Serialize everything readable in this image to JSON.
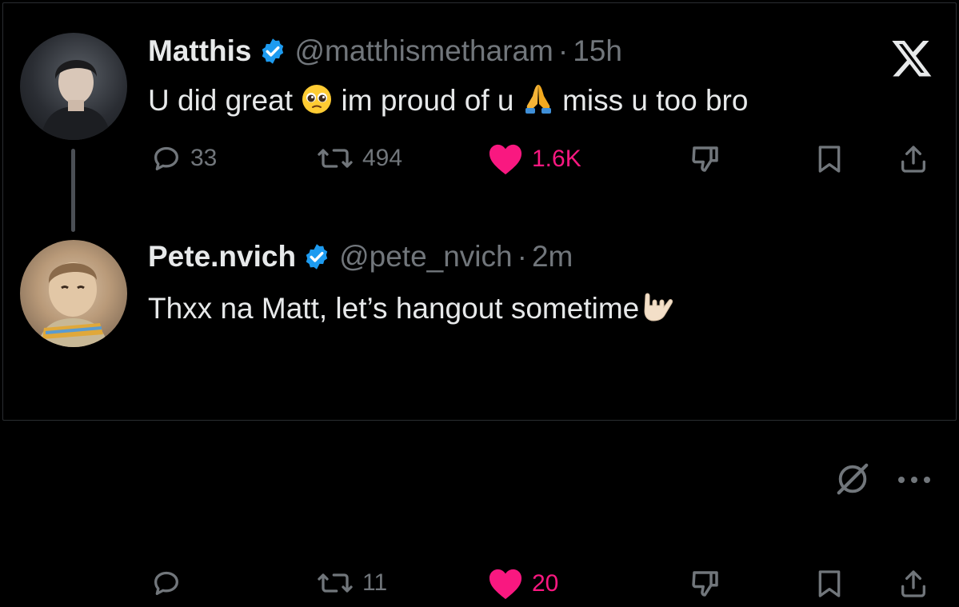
{
  "colors": {
    "background": "#000000",
    "text_primary": "#e7e9ea",
    "text_secondary": "#71767b",
    "verified_blue": "#1d9bf0",
    "like_pink": "#f91880"
  },
  "tweets": [
    {
      "author": {
        "name": "Matthis",
        "handle": "@matthismetharam",
        "verified": true
      },
      "separator": "·",
      "time": "15h",
      "text_parts": [
        "U did great ",
        " im proud of u ",
        " miss u too bro"
      ],
      "emojis": [
        "pleading-face",
        "folded-hands"
      ],
      "stats": {
        "replies": "33",
        "reposts": "494",
        "likes": "1.6K"
      },
      "liked": true,
      "corner_icon": "x-logo-icon"
    },
    {
      "author": {
        "name": "Pete.nvich",
        "handle": "@pete_nvich",
        "verified": true
      },
      "separator": "·",
      "time": "2m",
      "text_parts": [
        "Thxx na Matt, let’s hangout sometime"
      ],
      "emojis": [
        "love-you-gesture"
      ],
      "stats": {
        "replies": "",
        "reposts": "11",
        "likes": "20"
      },
      "liked": true,
      "corner_icon": "grok-icon"
    }
  ]
}
